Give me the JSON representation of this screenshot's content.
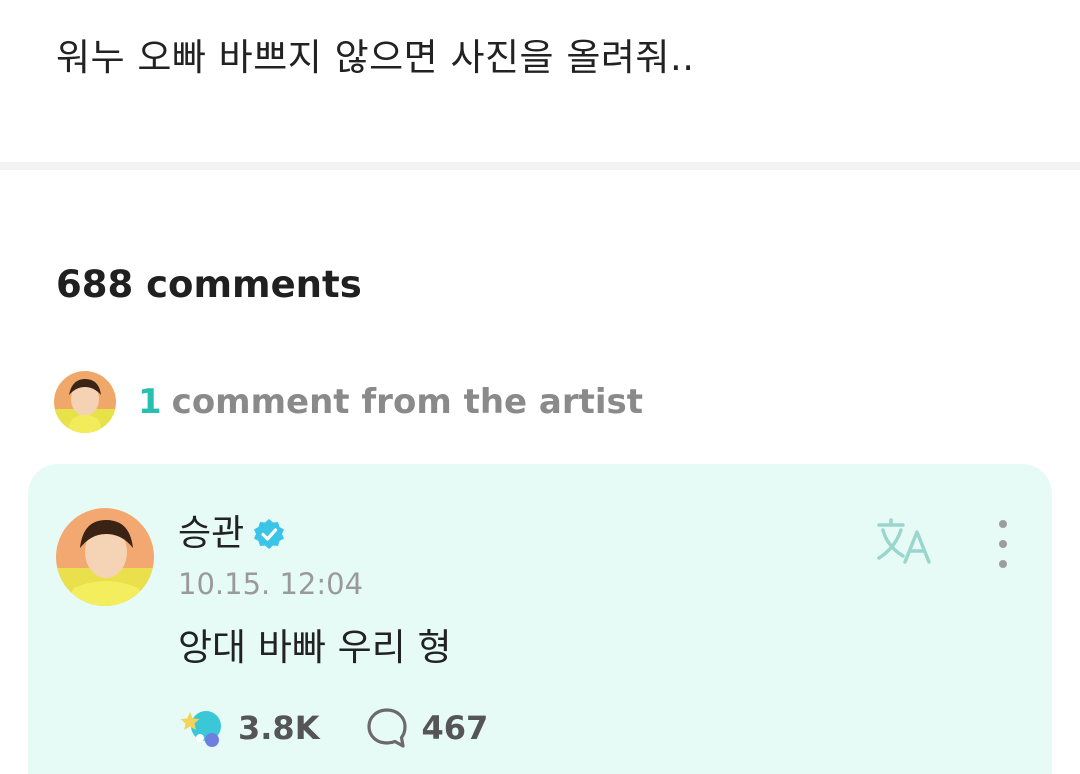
{
  "post": {
    "text": "워누 오빠 바쁘지 않으면 사진을 올려줘.."
  },
  "comments": {
    "count_label": "688 comments"
  },
  "artist_summary": {
    "count": "1",
    "label": "comment from the artist"
  },
  "artist_comment": {
    "author": "승관",
    "timestamp": "10.15. 12:04",
    "body": "앙대 바빠 우리 형",
    "likes": "3.8K",
    "replies": "467"
  },
  "colors": {
    "accent": "#26bfb0",
    "card_background": "#e7fbf6",
    "verified_badge": "#3ac4e8"
  },
  "icons": {
    "verified": "verified-badge-icon",
    "translate": "translate-icon",
    "more": "more-vertical-icon",
    "like": "like-reaction-icon",
    "reply": "comment-bubble-icon"
  }
}
